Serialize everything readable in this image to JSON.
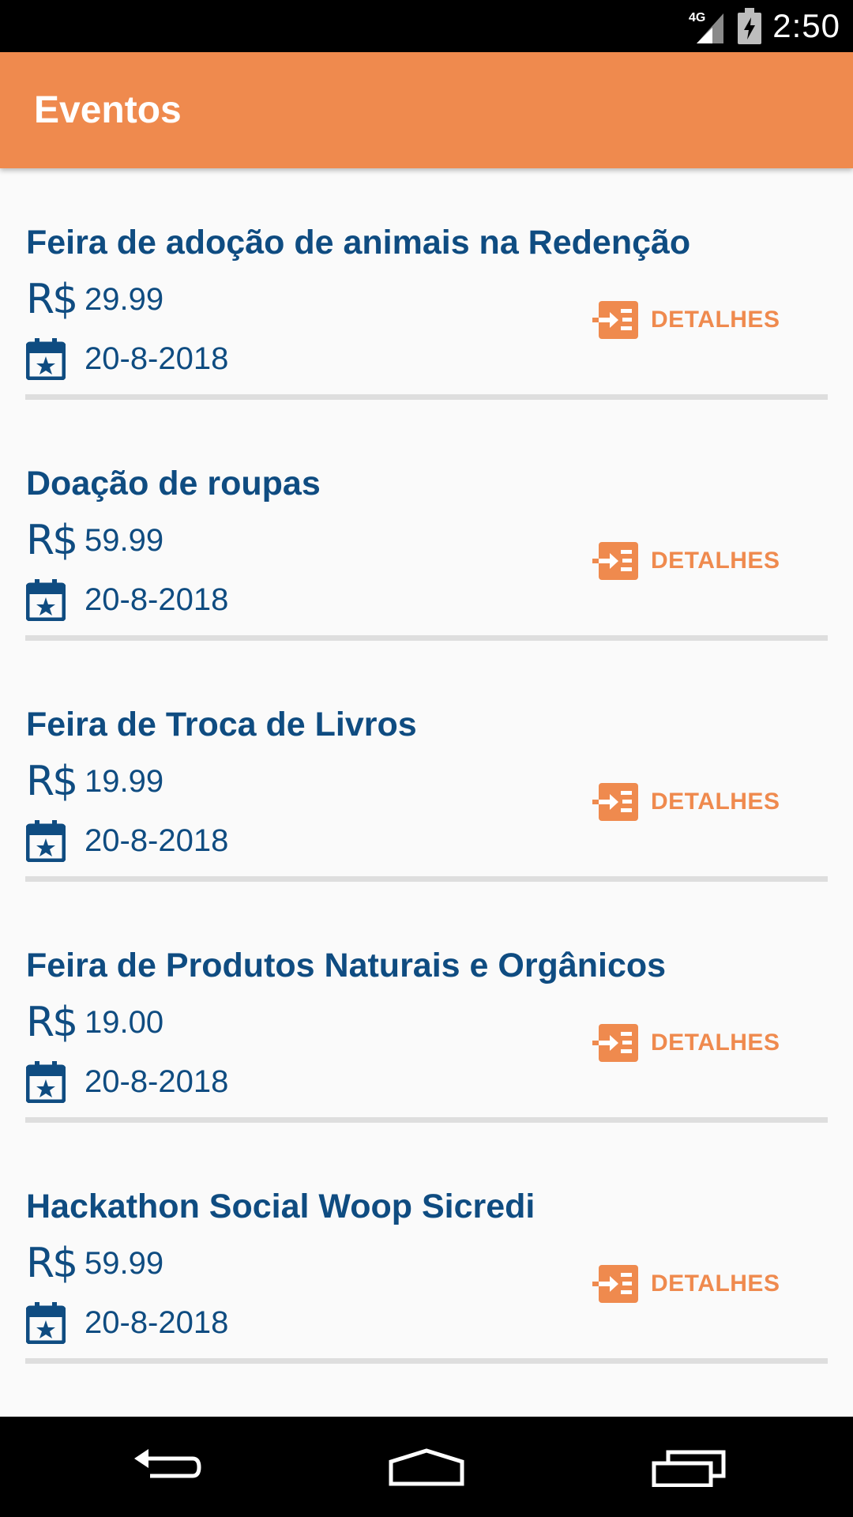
{
  "status_bar": {
    "network": "4G",
    "time": "2:50"
  },
  "app_bar": {
    "title": "Eventos"
  },
  "currency_symbol": "R$",
  "events": [
    {
      "title": "Feira de adoção de animais na Redenção",
      "price": "29.99",
      "date": "20-8-2018",
      "details_label": "DETALHES"
    },
    {
      "title": "Doação de roupas",
      "price": "59.99",
      "date": "20-8-2018",
      "details_label": "DETALHES"
    },
    {
      "title": "Feira de Troca de Livros",
      "price": "19.99",
      "date": "20-8-2018",
      "details_label": "DETALHES"
    },
    {
      "title": "Feira de Produtos Naturais e Orgânicos",
      "price": "19.00",
      "date": "20-8-2018",
      "details_label": "DETALHES"
    },
    {
      "title": "Hackathon Social Woop Sicredi",
      "price": "59.99",
      "date": "20-8-2018",
      "details_label": "DETALHES"
    }
  ],
  "icons": {
    "currency": "currency-icon",
    "date": "calendar-icon",
    "details": "details-icon",
    "nav": [
      "back-icon",
      "home-icon",
      "recents-icon"
    ]
  },
  "colors": {
    "accent": "#ef8a4e",
    "primary_text": "#0f4c81",
    "divider": "#dedede"
  }
}
